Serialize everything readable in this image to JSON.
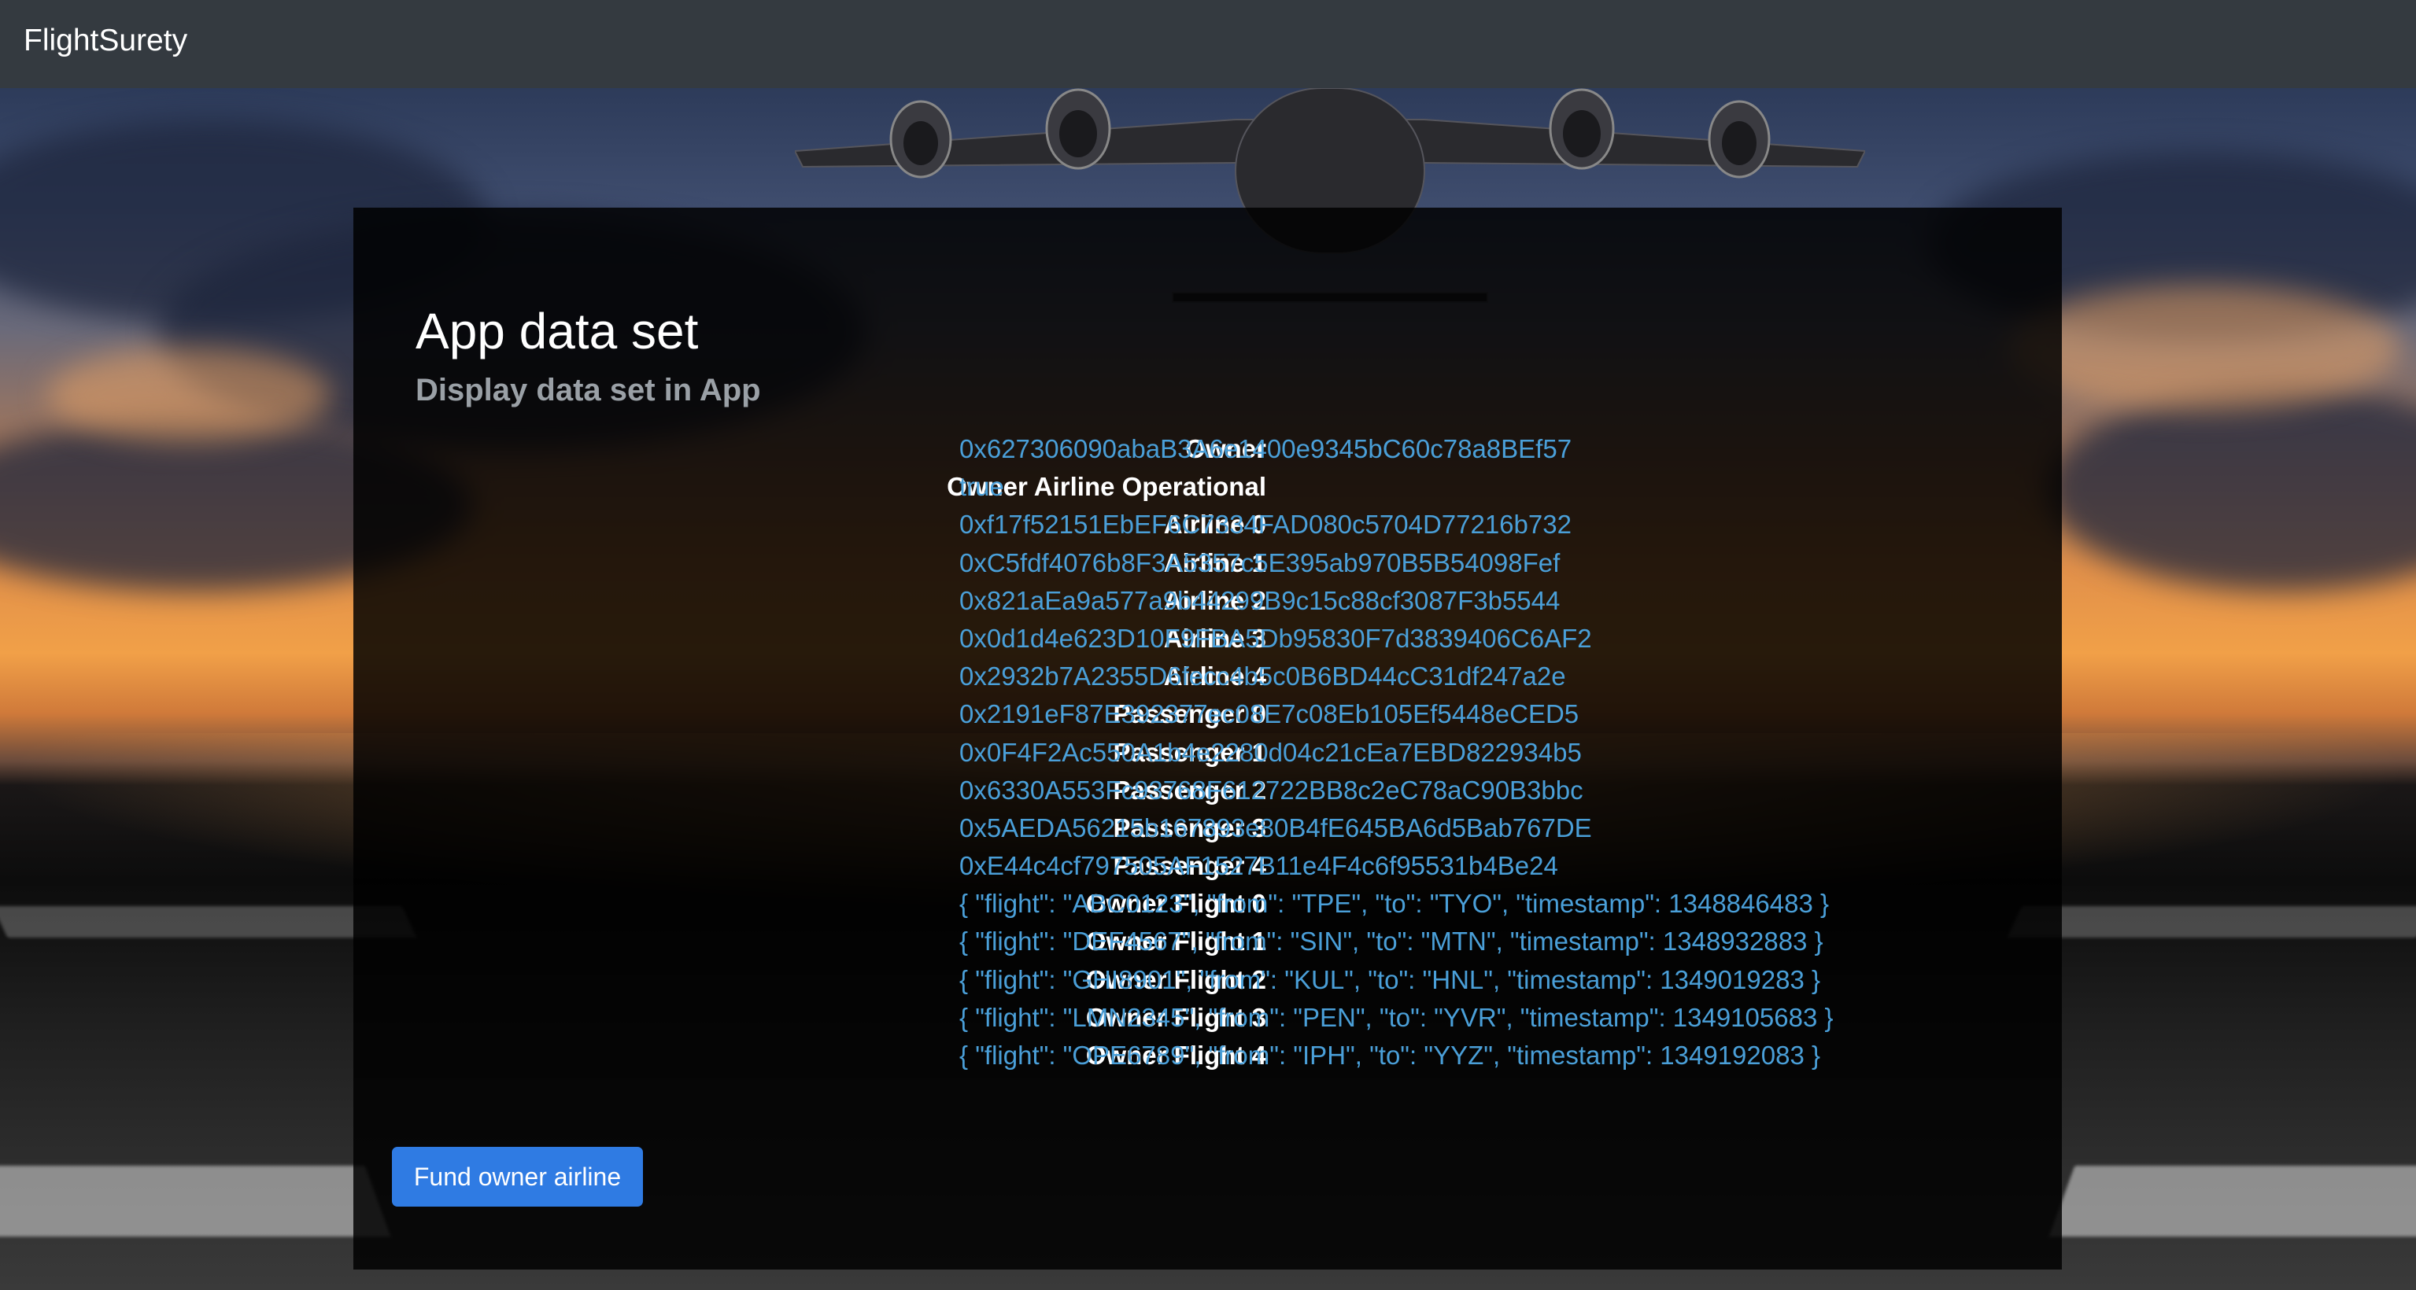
{
  "navbar": {
    "brand": "FlightSurety"
  },
  "panel": {
    "title": "App data set",
    "subtitle": "Display data set in App",
    "rows": [
      {
        "label": "Owner",
        "value": "0x627306090abaB3A6e1400e9345bC60c78a8BEf57"
      },
      {
        "label": "Owner Airline Operational",
        "value": "true"
      },
      {
        "label": "Airline 0",
        "value": "0xf17f52151EbEF6C7334FAD080c5704D77216b732"
      },
      {
        "label": "Airline 1",
        "value": "0xC5fdf4076b8F3A5357c5E395ab970B5B54098Fef"
      },
      {
        "label": "Airline 2",
        "value": "0x821aEa9a577a9b44299B9c15c88cf3087F3b5544"
      },
      {
        "label": "Airline 3",
        "value": "0x0d1d4e623D10F9FBA5Db95830F7d3839406C6AF2"
      },
      {
        "label": "Airline 4",
        "value": "0x2932b7A2355D6fecc4b5c0B6BD44cC31df247a2e"
      },
      {
        "label": "Passenger 0",
        "value": "0x2191eF87E392377ec08E7c08Eb105Ef5448eCED5"
      },
      {
        "label": "Passenger 1",
        "value": "0x0F4F2Ac550A1b4e2280d04c21cEa7EBD822934b5"
      },
      {
        "label": "Passenger 2",
        "value": "0x6330A553Fc93768F612722BB8c2eC78aC90B3bbc"
      },
      {
        "label": "Passenger 3",
        "value": "0x5AEDA56215b167893e80B4fE645BA6d5Bab767DE"
      },
      {
        "label": "Passenger 4",
        "value": "0xE44c4cf797505AF1527B11e4F4c6f95531b4Be24"
      },
      {
        "label": "Owner Flight 0",
        "value": "{ \"flight\": \"ABC0123\", \"from\": \"TPE\", \"to\": \"TYO\", \"timestamp\": 1348846483 }"
      },
      {
        "label": "Owner Flight 1",
        "value": "{ \"flight\": \"DEF4567\", \"from\": \"SIN\", \"to\": \"MTN\", \"timestamp\": 1348932883 }"
      },
      {
        "label": "Owner Flight 2",
        "value": "{ \"flight\": \"GHI8901\", \"from\": \"KUL\", \"to\": \"HNL\", \"timestamp\": 1349019283 }"
      },
      {
        "label": "Owner Flight 3",
        "value": "{ \"flight\": \"LMN2345\", \"from\": \"PEN\", \"to\": \"YVR\", \"timestamp\": 1349105683 }"
      },
      {
        "label": "Owner Flight 4",
        "value": "{ \"flight\": \"OPE6789\", \"from\": \"IPH\", \"to\": \"YYZ\", \"timestamp\": 1349192083 }"
      }
    ],
    "fund_button_label": "Fund owner airline"
  },
  "colors": {
    "navbar_bg": "#343a40",
    "value_text": "#4a9fd8",
    "button_bg": "#2f7be3",
    "subtitle_text": "#9aa0a6"
  }
}
